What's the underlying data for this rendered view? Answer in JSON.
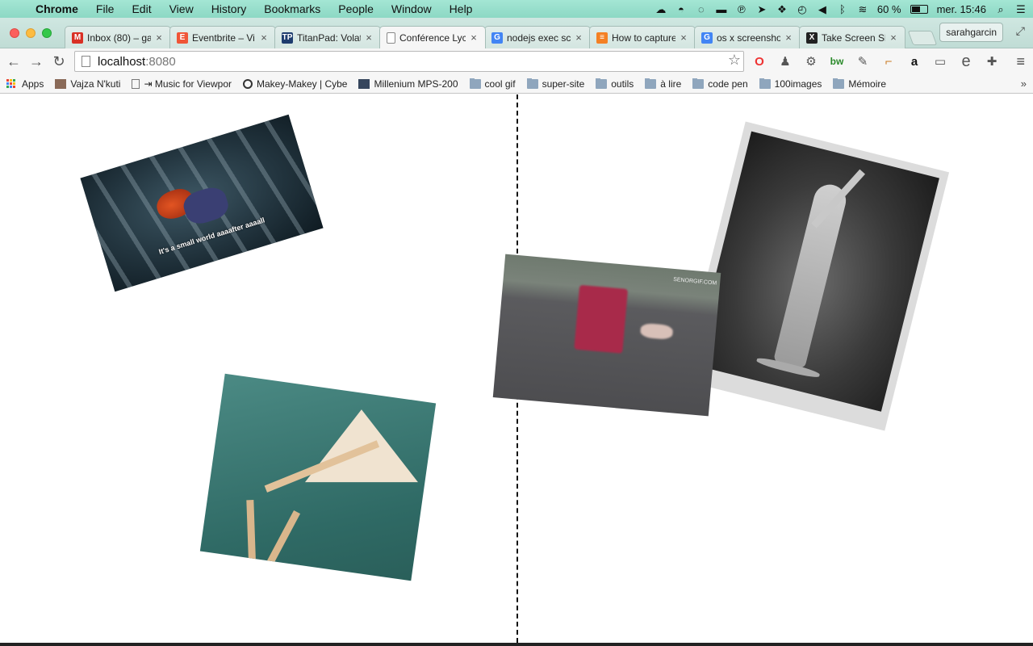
{
  "menubar": {
    "app": "Chrome",
    "items": [
      "File",
      "Edit",
      "View",
      "History",
      "Bookmarks",
      "People",
      "Window",
      "Help"
    ],
    "battery": "60 %",
    "clock": "mer. 15:46"
  },
  "tabs": [
    {
      "title": "Inbox (80) – ga",
      "icon": "gmail-icon",
      "color": "#d93025",
      "glyph": "M"
    },
    {
      "title": "Eventbrite – Vi",
      "icon": "eventbrite-icon",
      "color": "#f05537",
      "glyph": "E"
    },
    {
      "title": "TitanPad: Volat",
      "icon": "titanpad-icon",
      "color": "#1d3c6e",
      "glyph": "TP"
    },
    {
      "title": "Conférence Lyc",
      "icon": "page-icon",
      "color": "#ffffff",
      "glyph": ""
    },
    {
      "title": "nodejs exec sc",
      "icon": "google-icon",
      "color": "#4285f4",
      "glyph": "G"
    },
    {
      "title": "How to capture",
      "icon": "stackoverflow-icon",
      "color": "#f48024",
      "glyph": "≡"
    },
    {
      "title": "os x screensho",
      "icon": "google-icon",
      "color": "#4285f4",
      "glyph": "G"
    },
    {
      "title": "Take Screen Sh",
      "icon": "x-icon",
      "color": "#222222",
      "glyph": "X"
    }
  ],
  "active_tab_index": 3,
  "profile": "sarahgarcin",
  "omnibox": {
    "host": "localhost",
    "port": ":8080"
  },
  "bookmarks": [
    {
      "label": "Apps",
      "type": "apps"
    },
    {
      "label": "Vajza N'kuti",
      "type": "avatar"
    },
    {
      "label": "⇥ Music for Viewpor",
      "type": "page"
    },
    {
      "label": "Makey-Makey | Cybe",
      "type": "site"
    },
    {
      "label": "Millenium MPS-200",
      "type": "tumblr"
    },
    {
      "label": "cool gif",
      "type": "folder"
    },
    {
      "label": "super-site",
      "type": "folder"
    },
    {
      "label": "outils",
      "type": "folder"
    },
    {
      "label": "à lire",
      "type": "folder"
    },
    {
      "label": "code pen",
      "type": "folder"
    },
    {
      "label": "100images",
      "type": "folder"
    },
    {
      "label": "Mémoire",
      "type": "folder"
    }
  ],
  "page": {
    "zazu_caption": "It's a small world aaaafter aaaall",
    "cart_watermark": "SENORGIF.COM"
  }
}
